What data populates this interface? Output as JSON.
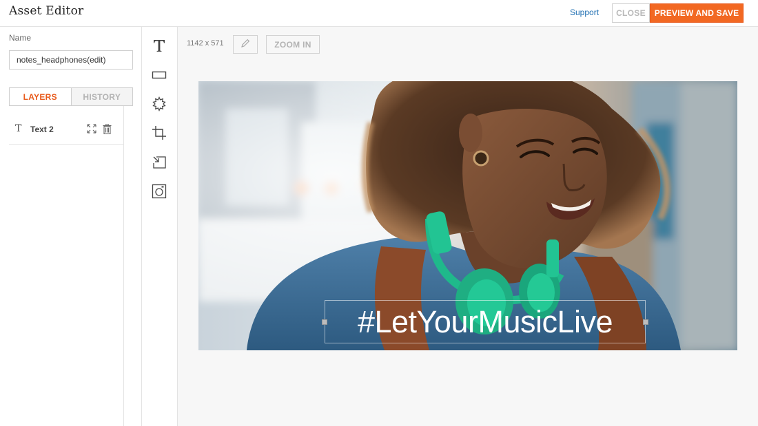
{
  "header": {
    "title": "Asset Editor",
    "support_label": "Support",
    "close_label": "CLOSE",
    "preview_save_label": "PREVIEW AND SAVE",
    "accent_color": "#f26822"
  },
  "left_panel": {
    "name_label": "Name",
    "name_value": "notes_headphones(edit)",
    "tabs": [
      {
        "label": "LAYERS",
        "active": true
      },
      {
        "label": "HISTORY",
        "active": false
      }
    ],
    "layers": [
      {
        "type_icon": "T",
        "name": "Text 2",
        "actions": [
          "expand-icon",
          "trash-icon"
        ]
      }
    ]
  },
  "tools": [
    {
      "name": "text-tool-icon"
    },
    {
      "name": "rectangle-tool-icon"
    },
    {
      "name": "badge-tool-icon"
    },
    {
      "name": "crop-tool-icon"
    },
    {
      "name": "resize-tool-icon"
    },
    {
      "name": "image-tool-icon"
    }
  ],
  "canvas": {
    "dimensions": "1142 x 571",
    "zoom_label": "ZOOM IN",
    "overlay_text": "#LetYourMusicLive"
  }
}
